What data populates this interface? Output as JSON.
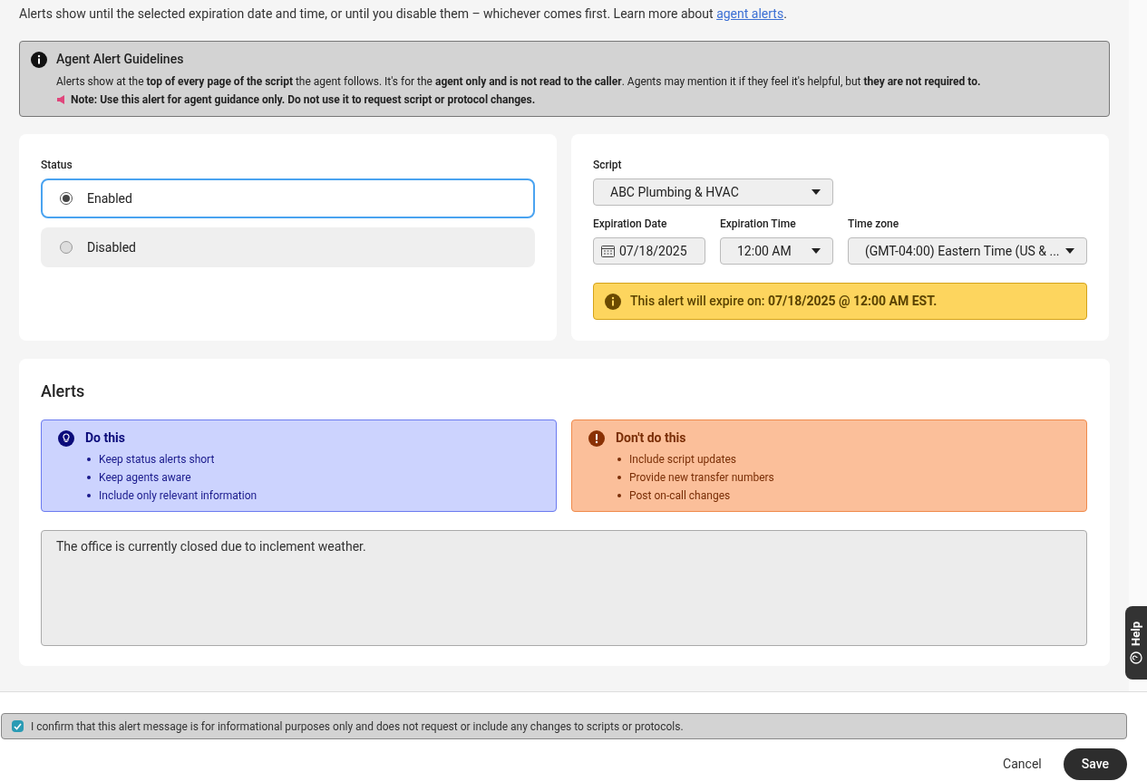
{
  "intro": {
    "text": "Alerts show until the selected expiration date and time, or until you disable them – whichever comes first. Learn more about ",
    "link": "agent alerts",
    "suffix": "."
  },
  "guidelines": {
    "title": "Agent Alert Guidelines",
    "body": "Alerts show at the **top of every page of the script** the agent follows. It's for the **agent only and is not read to the caller**. Agents may mention it if they feel it's helpful, but **they are not required to.**",
    "note": "Note: Use this alert for agent guidance only. Do not use it to request script or protocol changes."
  },
  "status": {
    "label": "Status",
    "options": [
      {
        "label": "Enabled",
        "selected": true
      },
      {
        "label": "Disabled",
        "selected": false
      }
    ]
  },
  "script": {
    "label": "Script",
    "value": "ABC Plumbing & HVAC"
  },
  "expiration_date": {
    "label": "Expiration Date",
    "value": "07/18/2025"
  },
  "expiration_time": {
    "label": "Expiration Time",
    "value": "12:00 AM"
  },
  "time_zone": {
    "label": "Time zone",
    "value": "(GMT-04:00) Eastern Time (US & ..."
  },
  "expiry_notice": "This alert will expire on: **07/18/2025 @ 12:00 AM EST.**",
  "alerts": {
    "title": "Alerts",
    "panels": [
      {
        "kind": "do",
        "title": "Do this",
        "items": [
          "Keep status alerts short",
          "Keep agents aware",
          "Include only relevant information"
        ]
      },
      {
        "kind": "dont",
        "title": "Don't do this",
        "items": [
          "Include script updates",
          "Provide new transfer numbers",
          "Post on-call changes"
        ]
      }
    ],
    "message": "The office is currently closed due to inclement weather."
  },
  "help": "Help",
  "confirm": {
    "checked": true,
    "text": "I confirm that this alert message is for informational purposes only and does not request or include any changes to scripts or protocols."
  },
  "buttons": {
    "cancel": "Cancel",
    "save": "Save"
  }
}
